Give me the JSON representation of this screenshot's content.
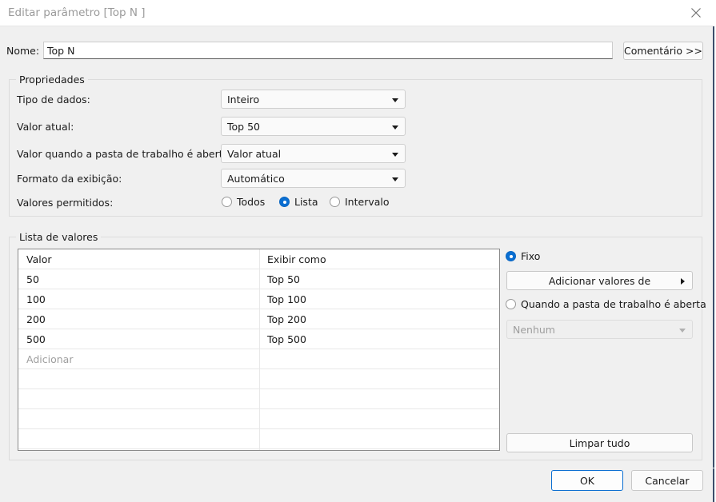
{
  "window": {
    "title": "Editar parâmetro [Top N ]",
    "close_icon": "close-icon"
  },
  "name_row": {
    "label": "Nome:",
    "value": "Top N",
    "placeholder": "",
    "comment_button": "Comentário >>"
  },
  "properties": {
    "group_title": "Propriedades",
    "data_type": {
      "label": "Tipo de dados:",
      "value": "Inteiro"
    },
    "current_value": {
      "label": "Valor atual:",
      "value": "Top 50"
    },
    "workbook_open_value": {
      "label": "Valor quando a pasta de trabalho é aberta:",
      "value": "Valor atual"
    },
    "display_format": {
      "label": "Formato da exibição:",
      "value": "Automático"
    },
    "allowed_values": {
      "label": "Valores permitidos:",
      "options": [
        {
          "label": "Todos",
          "selected": false
        },
        {
          "label": "Lista",
          "selected": true
        },
        {
          "label": "Intervalo",
          "selected": false
        }
      ]
    }
  },
  "value_list": {
    "group_title": "Lista de valores",
    "columns": [
      "Valor",
      "Exibir como"
    ],
    "rows": [
      {
        "value": "50",
        "display_as": "Top 50"
      },
      {
        "value": "100",
        "display_as": "Top 100"
      },
      {
        "value": "200",
        "display_as": "Top 200"
      },
      {
        "value": "500",
        "display_as": "Top 500"
      }
    ],
    "add_placeholder": "Adicionar",
    "empty_row_count": 5,
    "side_panel": {
      "source_options": [
        {
          "label": "Fixo",
          "selected": true
        },
        {
          "label": "Quando a pasta de trabalho é aberta",
          "selected": false
        }
      ],
      "add_values_button": "Adicionar valores de",
      "source_dropdown_value": "Nenhum",
      "source_dropdown_disabled": true,
      "clear_all_button": "Limpar tudo"
    }
  },
  "footer": {
    "ok_button": "OK",
    "cancel_button": "Cancelar"
  },
  "colors": {
    "accent": "#0a6ed1",
    "dialog_bg": "#f0f0f0",
    "titlebar_bg": "#ffffff",
    "title_text": "#9a9a9a",
    "placeholder_text": "#9e9e9e",
    "background_window_edge": "#3c4f6b"
  }
}
